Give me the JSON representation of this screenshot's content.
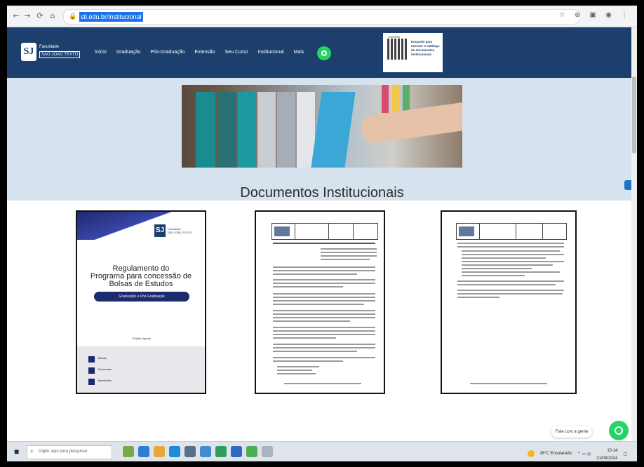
{
  "browser": {
    "url": "sti.edu.br/institucional",
    "back": "←",
    "forward": "→",
    "reload": "⟳",
    "home": "⌂"
  },
  "site": {
    "logo_line1": "Faculdade",
    "logo_line2": "SÃO JOÃO TEXTO",
    "menu": [
      "Início",
      "Graduação",
      "Pós-Graduação",
      "Extensão",
      "Seu Curso",
      "Institucional",
      "Mais"
    ],
    "qr_label": "ACESSE",
    "qr_text": "Escaneie para acessar o catálogo de documentos institucionais"
  },
  "page": {
    "title": "Documentos Institucionais"
  },
  "documents": [
    {
      "title_line1": "Regulamento do",
      "title_line2": "Programa para concessão de",
      "title_line3": "Bolsas de Estudos",
      "pill": "Graduação e Pós-Graduação",
      "edition": "Edição vigente",
      "rows": [
        "Bolsas",
        "Descontos",
        "Benefícios"
      ]
    },
    {
      "type": "page"
    },
    {
      "type": "page"
    }
  ],
  "chat": {
    "label": "Fale com a gente"
  },
  "taskbar": {
    "search_placeholder": "Digite aqui para pesquisar",
    "weather": "26°C  Ensolarado",
    "time": "10:14",
    "date": "21/03/2024"
  }
}
